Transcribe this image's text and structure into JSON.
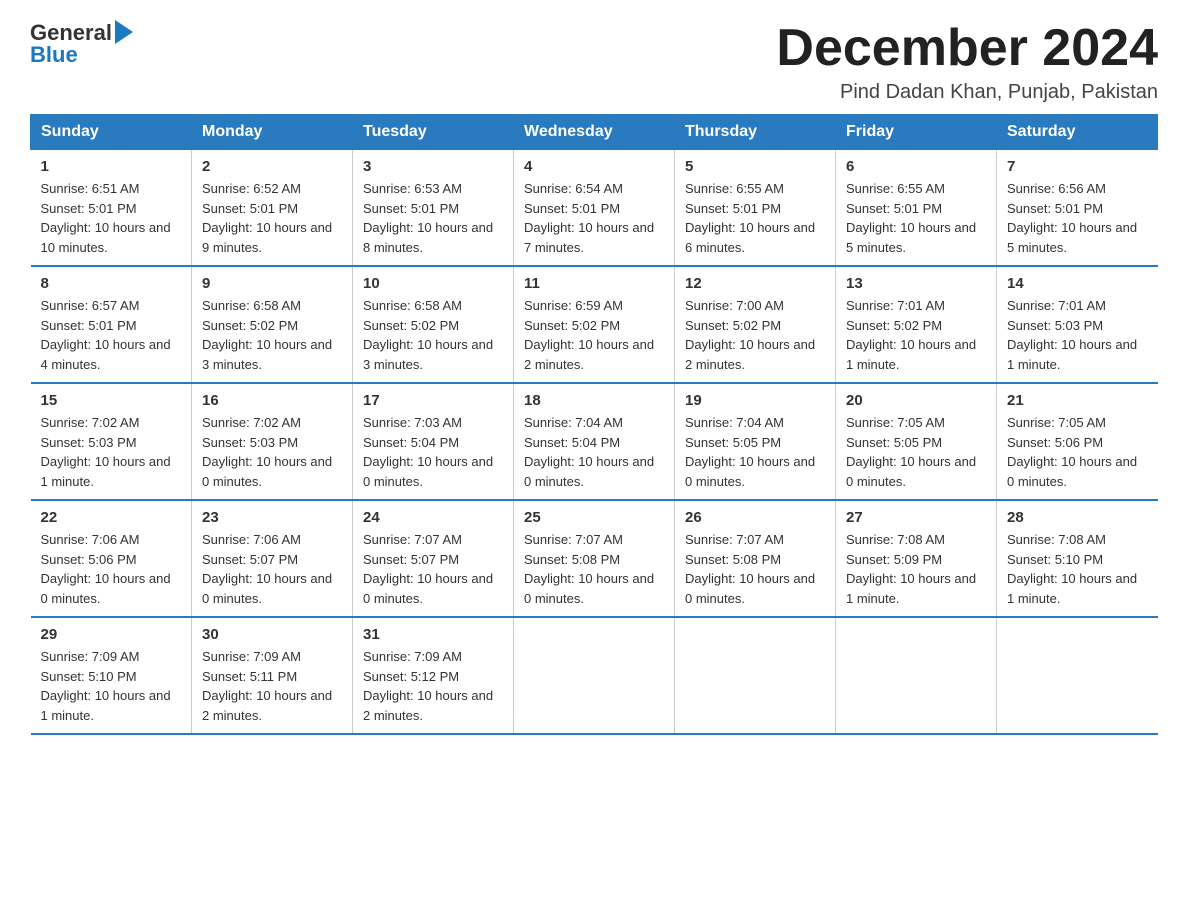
{
  "header": {
    "logo_general": "General",
    "logo_blue": "Blue",
    "month_title": "December 2024",
    "location": "Pind Dadan Khan, Punjab, Pakistan"
  },
  "days_of_week": [
    "Sunday",
    "Monday",
    "Tuesday",
    "Wednesday",
    "Thursday",
    "Friday",
    "Saturday"
  ],
  "weeks": [
    [
      {
        "date": "1",
        "sunrise": "Sunrise: 6:51 AM",
        "sunset": "Sunset: 5:01 PM",
        "daylight": "Daylight: 10 hours and 10 minutes."
      },
      {
        "date": "2",
        "sunrise": "Sunrise: 6:52 AM",
        "sunset": "Sunset: 5:01 PM",
        "daylight": "Daylight: 10 hours and 9 minutes."
      },
      {
        "date": "3",
        "sunrise": "Sunrise: 6:53 AM",
        "sunset": "Sunset: 5:01 PM",
        "daylight": "Daylight: 10 hours and 8 minutes."
      },
      {
        "date": "4",
        "sunrise": "Sunrise: 6:54 AM",
        "sunset": "Sunset: 5:01 PM",
        "daylight": "Daylight: 10 hours and 7 minutes."
      },
      {
        "date": "5",
        "sunrise": "Sunrise: 6:55 AM",
        "sunset": "Sunset: 5:01 PM",
        "daylight": "Daylight: 10 hours and 6 minutes."
      },
      {
        "date": "6",
        "sunrise": "Sunrise: 6:55 AM",
        "sunset": "Sunset: 5:01 PM",
        "daylight": "Daylight: 10 hours and 5 minutes."
      },
      {
        "date": "7",
        "sunrise": "Sunrise: 6:56 AM",
        "sunset": "Sunset: 5:01 PM",
        "daylight": "Daylight: 10 hours and 5 minutes."
      }
    ],
    [
      {
        "date": "8",
        "sunrise": "Sunrise: 6:57 AM",
        "sunset": "Sunset: 5:01 PM",
        "daylight": "Daylight: 10 hours and 4 minutes."
      },
      {
        "date": "9",
        "sunrise": "Sunrise: 6:58 AM",
        "sunset": "Sunset: 5:02 PM",
        "daylight": "Daylight: 10 hours and 3 minutes."
      },
      {
        "date": "10",
        "sunrise": "Sunrise: 6:58 AM",
        "sunset": "Sunset: 5:02 PM",
        "daylight": "Daylight: 10 hours and 3 minutes."
      },
      {
        "date": "11",
        "sunrise": "Sunrise: 6:59 AM",
        "sunset": "Sunset: 5:02 PM",
        "daylight": "Daylight: 10 hours and 2 minutes."
      },
      {
        "date": "12",
        "sunrise": "Sunrise: 7:00 AM",
        "sunset": "Sunset: 5:02 PM",
        "daylight": "Daylight: 10 hours and 2 minutes."
      },
      {
        "date": "13",
        "sunrise": "Sunrise: 7:01 AM",
        "sunset": "Sunset: 5:02 PM",
        "daylight": "Daylight: 10 hours and 1 minute."
      },
      {
        "date": "14",
        "sunrise": "Sunrise: 7:01 AM",
        "sunset": "Sunset: 5:03 PM",
        "daylight": "Daylight: 10 hours and 1 minute."
      }
    ],
    [
      {
        "date": "15",
        "sunrise": "Sunrise: 7:02 AM",
        "sunset": "Sunset: 5:03 PM",
        "daylight": "Daylight: 10 hours and 1 minute."
      },
      {
        "date": "16",
        "sunrise": "Sunrise: 7:02 AM",
        "sunset": "Sunset: 5:03 PM",
        "daylight": "Daylight: 10 hours and 0 minutes."
      },
      {
        "date": "17",
        "sunrise": "Sunrise: 7:03 AM",
        "sunset": "Sunset: 5:04 PM",
        "daylight": "Daylight: 10 hours and 0 minutes."
      },
      {
        "date": "18",
        "sunrise": "Sunrise: 7:04 AM",
        "sunset": "Sunset: 5:04 PM",
        "daylight": "Daylight: 10 hours and 0 minutes."
      },
      {
        "date": "19",
        "sunrise": "Sunrise: 7:04 AM",
        "sunset": "Sunset: 5:05 PM",
        "daylight": "Daylight: 10 hours and 0 minutes."
      },
      {
        "date": "20",
        "sunrise": "Sunrise: 7:05 AM",
        "sunset": "Sunset: 5:05 PM",
        "daylight": "Daylight: 10 hours and 0 minutes."
      },
      {
        "date": "21",
        "sunrise": "Sunrise: 7:05 AM",
        "sunset": "Sunset: 5:06 PM",
        "daylight": "Daylight: 10 hours and 0 minutes."
      }
    ],
    [
      {
        "date": "22",
        "sunrise": "Sunrise: 7:06 AM",
        "sunset": "Sunset: 5:06 PM",
        "daylight": "Daylight: 10 hours and 0 minutes."
      },
      {
        "date": "23",
        "sunrise": "Sunrise: 7:06 AM",
        "sunset": "Sunset: 5:07 PM",
        "daylight": "Daylight: 10 hours and 0 minutes."
      },
      {
        "date": "24",
        "sunrise": "Sunrise: 7:07 AM",
        "sunset": "Sunset: 5:07 PM",
        "daylight": "Daylight: 10 hours and 0 minutes."
      },
      {
        "date": "25",
        "sunrise": "Sunrise: 7:07 AM",
        "sunset": "Sunset: 5:08 PM",
        "daylight": "Daylight: 10 hours and 0 minutes."
      },
      {
        "date": "26",
        "sunrise": "Sunrise: 7:07 AM",
        "sunset": "Sunset: 5:08 PM",
        "daylight": "Daylight: 10 hours and 0 minutes."
      },
      {
        "date": "27",
        "sunrise": "Sunrise: 7:08 AM",
        "sunset": "Sunset: 5:09 PM",
        "daylight": "Daylight: 10 hours and 1 minute."
      },
      {
        "date": "28",
        "sunrise": "Sunrise: 7:08 AM",
        "sunset": "Sunset: 5:10 PM",
        "daylight": "Daylight: 10 hours and 1 minute."
      }
    ],
    [
      {
        "date": "29",
        "sunrise": "Sunrise: 7:09 AM",
        "sunset": "Sunset: 5:10 PM",
        "daylight": "Daylight: 10 hours and 1 minute."
      },
      {
        "date": "30",
        "sunrise": "Sunrise: 7:09 AM",
        "sunset": "Sunset: 5:11 PM",
        "daylight": "Daylight: 10 hours and 2 minutes."
      },
      {
        "date": "31",
        "sunrise": "Sunrise: 7:09 AM",
        "sunset": "Sunset: 5:12 PM",
        "daylight": "Daylight: 10 hours and 2 minutes."
      },
      null,
      null,
      null,
      null
    ]
  ]
}
